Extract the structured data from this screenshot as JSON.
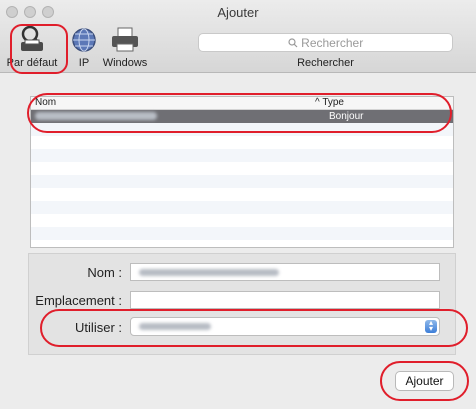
{
  "window": {
    "title": "Ajouter"
  },
  "toolbar": {
    "tools": [
      {
        "label": "Par défaut",
        "icon": "default-printer-icon"
      },
      {
        "label": "IP",
        "icon": "ip-globe-icon"
      },
      {
        "label": "Windows",
        "icon": "windows-printer-icon"
      }
    ],
    "search_placeholder": "Rechercher",
    "search_caption": "Rechercher"
  },
  "list": {
    "col_name": "Nom",
    "col_type": "Type",
    "sort_indicator": "^",
    "selected_row": {
      "name": "",
      "type": "Bonjour"
    }
  },
  "form": {
    "nom_label": "Nom :",
    "emplacement_label": "Emplacement :",
    "utiliser_label": "Utiliser :",
    "emplacement_value": ""
  },
  "actions": {
    "add_label": "Ajouter"
  },
  "colors": {
    "annotation": "#e01e2b",
    "selection": "#6f6f74",
    "accent": "#3d7ed8"
  }
}
